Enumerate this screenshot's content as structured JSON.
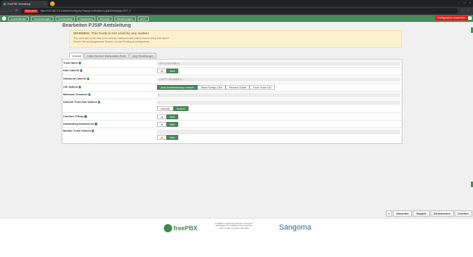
{
  "browser": {
    "tab_title": "FreePBX Verwaltung",
    "close_glyph": "×",
    "new_tab": "+",
    "window_controls": [
      "–",
      "□",
      "×"
    ],
    "nav": [
      "←",
      "→",
      "⟳"
    ],
    "insecure_label": "Nicht sicher",
    "url": "https://192.168.178.10/admin/config.php?display=trunks&tech=pjsip&extdisplay=OUT_2",
    "right_icons": [
      "☆",
      "⋮"
    ]
  },
  "menu": {
    "items": [
      "Administrator",
      "Anwendungen",
      "Connectivity",
      "Dashboard",
      "Berichte",
      "Einstellungen",
      "UCP"
    ],
    "apply": "Konfiguration anwenden"
  },
  "page": {
    "title": "Bearbeiten PJSIP Amtsleitung",
    "warning": {
      "title": "WARNING: This trunk is not used by any routes!",
      "line1": "This trunk will not be able to be used for outbound calls until a route is setup that uses it.",
      "line2": "Klicken Sie auf Ausgehende Routen, um das Routing zu konfigurieren."
    },
    "tabs": [
      "General",
      "Dialed Number Manipulation Rules",
      "pjsip Einstellungen"
    ]
  },
  "form": {
    "trunk_name": {
      "label": "Trunk Name",
      "value": "<ARTLCHNUMMER>"
    },
    "hide_callerid": {
      "label": "Hide CallerID",
      "options": [
        "Ja",
        "Nein"
      ],
      "selected": "Nein"
    },
    "outbound_callerid": {
      "label": "Outbound CallerID",
      "value": "<<ARTLCHNUMMER>>"
    },
    "cid_options": {
      "label": "CID Options",
      "options": [
        "Jede Anruferkennung zulassen",
        "Block Foreign CIDs",
        "Remove CNAM",
        "Force Trunk CID"
      ],
      "selected": "Jede Anruferkennung zulassen"
    },
    "max_channels": {
      "label": "Maximum Channels",
      "value": "0"
    },
    "dial_options": {
      "label": "Asterisk Trunk Dial Options",
      "value": "T",
      "options": [
        "Override",
        "System"
      ],
      "selected": "System"
    },
    "continue_busy": {
      "label": "Continue if Busy",
      "options": [
        "Ja",
        "Nein"
      ],
      "selected": "Nein"
    },
    "disable_trunk": {
      "label": "Amtsleitung deaktivieren",
      "options": [
        "Ja",
        "Nein"
      ],
      "selected": "Nein"
    },
    "monitor_failures": {
      "label": "Monitor Trunk Failures",
      "options": [
        "Ja",
        "Nein"
      ],
      "selected": "Nein"
    }
  },
  "buttons": {
    "arrow": "»",
    "submit": "Absenden",
    "duplicate": "Doppelt",
    "reset": "Zurücksetzen",
    "delete": "Löschen"
  },
  "footer": {
    "brand": "freePBX",
    "legal": "FreePBX is a registered trademark of Sangoma Technologies Inc. FreePBX 17.0.21 is licensed under the GPL Copyright© 2007-2025",
    "vendor": "Sangoma"
  },
  "colors": {
    "accent": "#4a8a5b",
    "danger": "#d9231d",
    "warning_bg": "#fcf1cf"
  }
}
